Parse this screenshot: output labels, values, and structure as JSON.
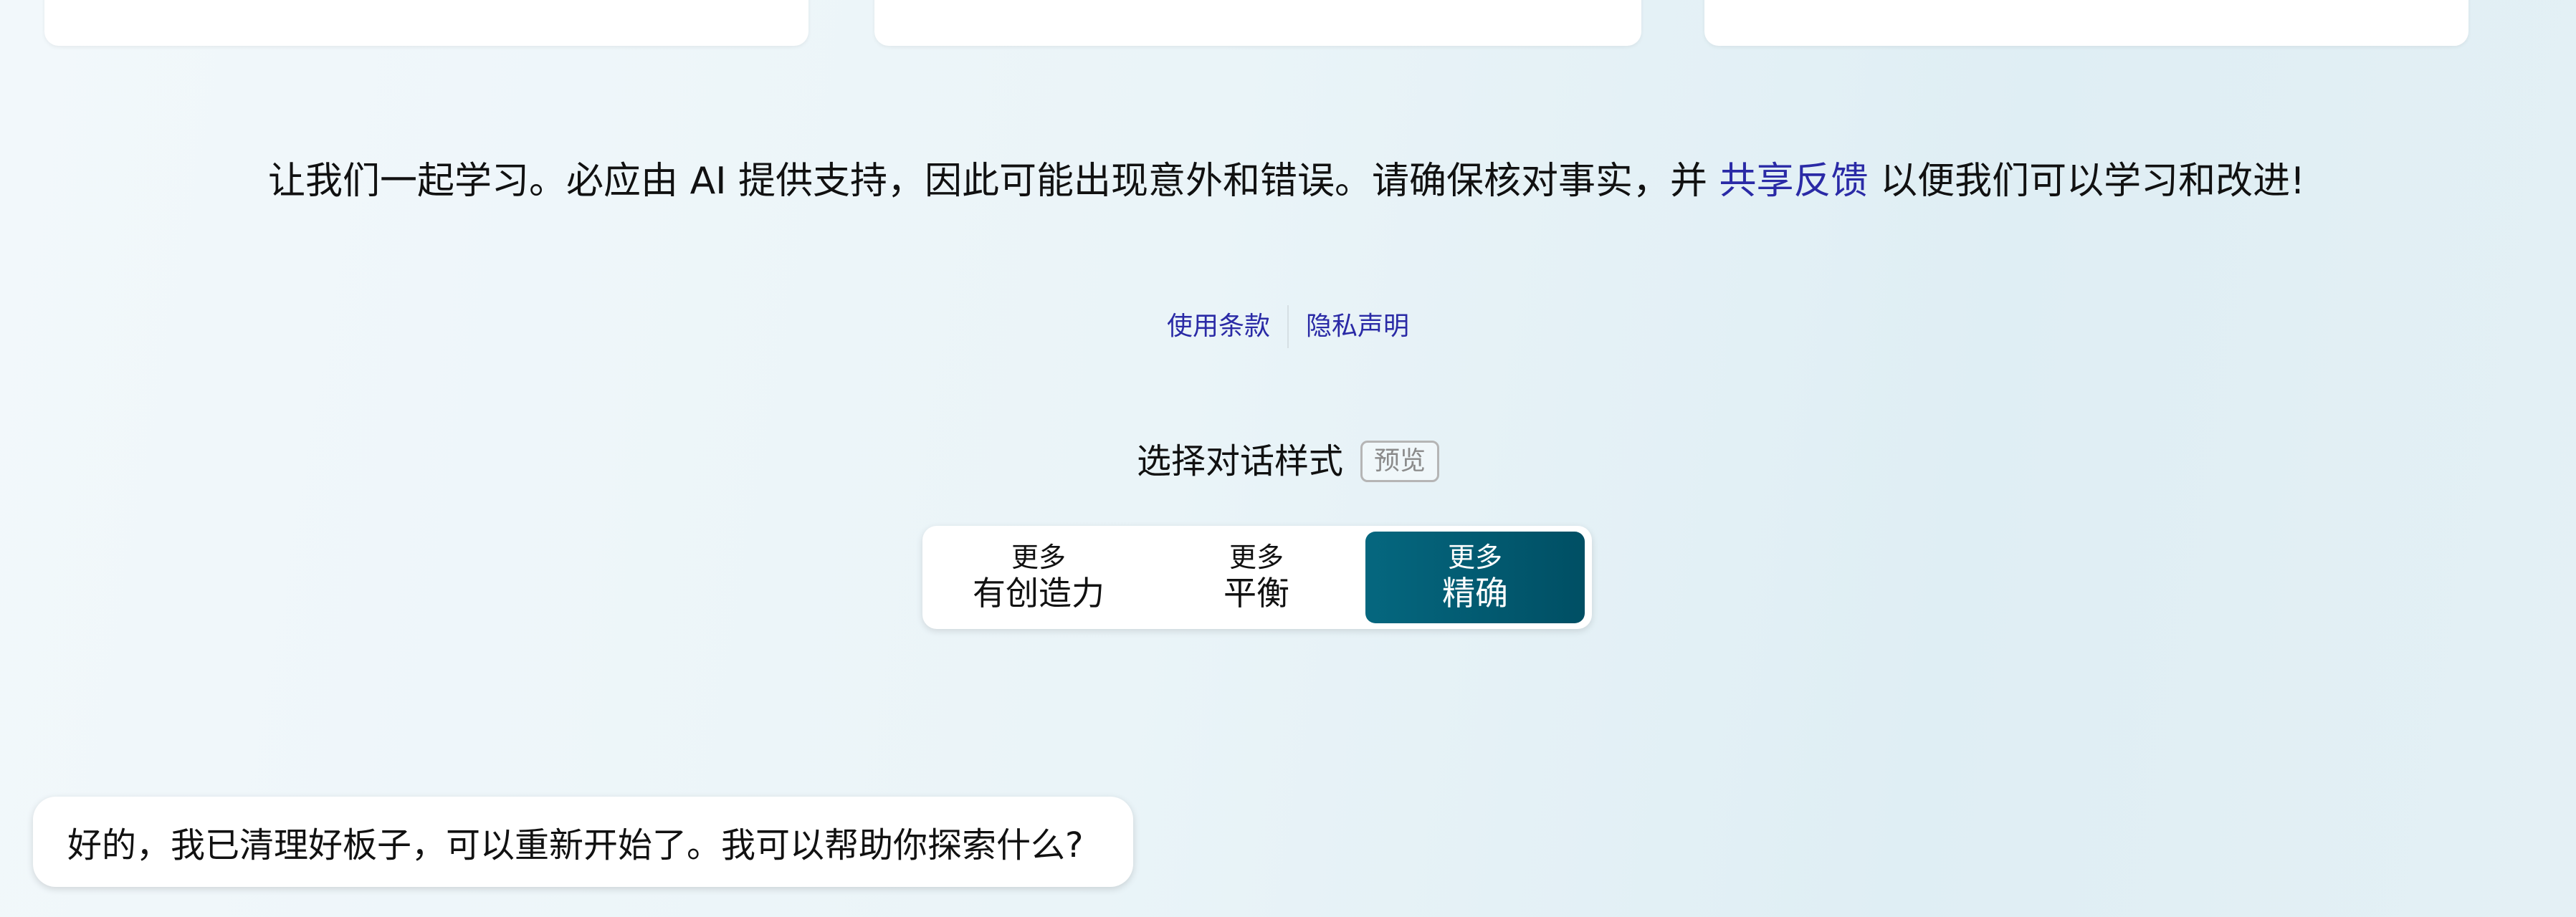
{
  "disclaimer": {
    "text_before": "让我们一起学习。必应由 AI 提供支持，因此可能出现意外和错误。请确保核对事实，并 ",
    "feedback_link": "共享反馈",
    "text_after": " 以便我们可以学习和改进!"
  },
  "legal": {
    "terms": "使用条款",
    "privacy": "隐私声明"
  },
  "conversation_style": {
    "title": "选择对话样式",
    "badge": "预览",
    "options": [
      {
        "line1": "更多",
        "line2": "有创造力",
        "selected": false
      },
      {
        "line1": "更多",
        "line2": "平衡",
        "selected": false
      },
      {
        "line1": "更多",
        "line2": "精确",
        "selected": true
      }
    ]
  },
  "bot_message": {
    "text": "好的，我已清理好板子，可以重新开始了。我可以帮助你探索什么?"
  },
  "colors": {
    "link": "#2a2aa6",
    "selected_option": "#05677f"
  }
}
